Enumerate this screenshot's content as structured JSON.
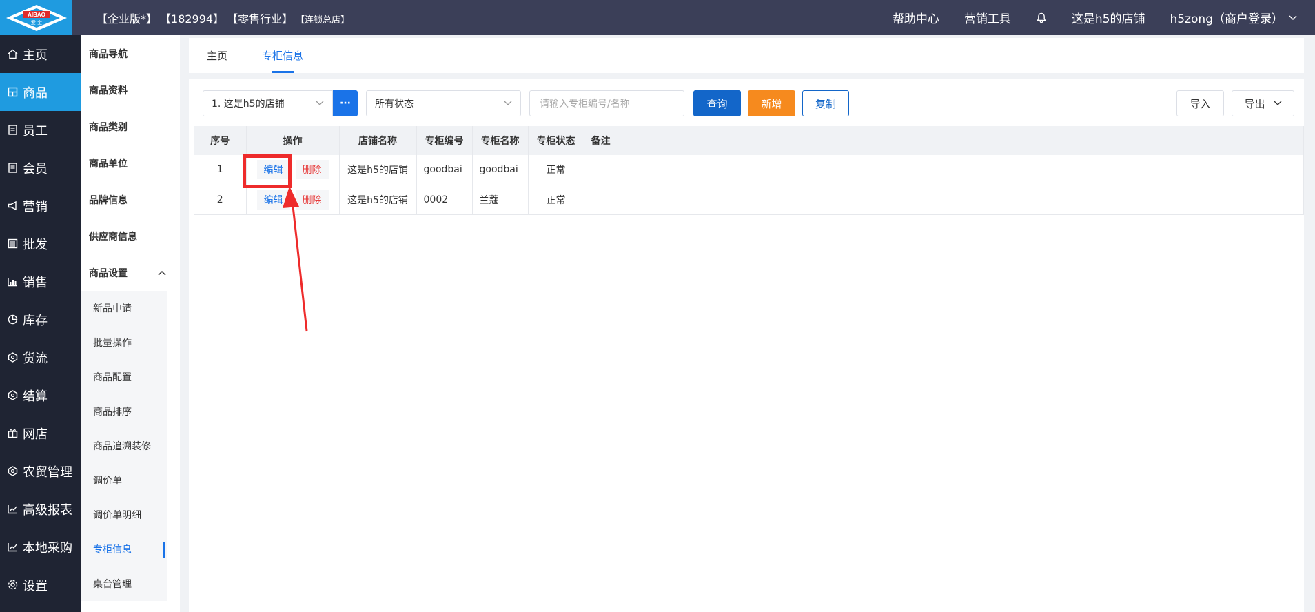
{
  "header": {
    "logo_text": "AIBAO",
    "logo_subtext": "爱 宝",
    "edition": "【企业版*】",
    "account_id": "【182994】",
    "industry": "【零售行业】",
    "store_type": "【连锁总店】",
    "help": "帮助中心",
    "marketing_tools": "营销工具",
    "store_name": "这是h5的店铺",
    "user": "h5zong（商户登录）"
  },
  "leftnav": [
    {
      "label": "主页",
      "icon": "home-icon"
    },
    {
      "label": "商品",
      "icon": "product-icon",
      "active": true
    },
    {
      "label": "员工",
      "icon": "staff-icon"
    },
    {
      "label": "会员",
      "icon": "member-icon"
    },
    {
      "label": "营销",
      "icon": "megaphone-icon"
    },
    {
      "label": "批发",
      "icon": "wholesale-icon"
    },
    {
      "label": "销售",
      "icon": "sales-chart-icon"
    },
    {
      "label": "库存",
      "icon": "inventory-icon"
    },
    {
      "label": "货流",
      "icon": "logistics-icon"
    },
    {
      "label": "结算",
      "icon": "settlement-icon"
    },
    {
      "label": "网店",
      "icon": "gift-icon"
    },
    {
      "label": "农贸管理",
      "icon": "farm-icon"
    },
    {
      "label": "高级报表",
      "icon": "report-icon"
    },
    {
      "label": "本地采购",
      "icon": "purchase-icon"
    },
    {
      "label": "设置",
      "icon": "gear-icon"
    }
  ],
  "subnav": {
    "items": [
      "商品导航",
      "商品资料",
      "商品类别",
      "商品单位",
      "品牌信息",
      "供应商信息"
    ],
    "group_label": "商品设置",
    "children": [
      "新品申请",
      "批量操作",
      "商品配置",
      "商品排序",
      "商品追溯装修",
      "调价单",
      "调价单明细",
      "专柜信息",
      "桌台管理"
    ],
    "active_child": "专柜信息"
  },
  "tabs": [
    {
      "label": "主页",
      "active": false
    },
    {
      "label": "专柜信息",
      "active": true
    }
  ],
  "filters": {
    "store_select": "1. 这是h5的店铺",
    "dots": "···",
    "status_select": "所有状态",
    "search_placeholder": "请输入专柜编号/名称",
    "query": "查询",
    "add": "新增",
    "copy": "复制",
    "import": "导入",
    "export": "导出"
  },
  "table": {
    "headers": [
      "序号",
      "操作",
      "店铺名称",
      "专柜编号",
      "专柜名称",
      "专柜状态",
      "备注"
    ],
    "edit_label": "编辑",
    "delete_label": "删除",
    "rows": [
      {
        "index": "1",
        "store": "这是h5的店铺",
        "code": "goodbai",
        "name": "goodbai",
        "status": "正常",
        "note": ""
      },
      {
        "index": "2",
        "store": "这是h5的店铺",
        "code": "0002",
        "name": "兰蔻",
        "status": "正常",
        "note": ""
      }
    ]
  },
  "colors": {
    "topbar": "#3b3f58",
    "accent": "#1f9be0",
    "primary": "#1366c9",
    "orange": "#f68a1e",
    "highlight": "#ee2b2b"
  }
}
